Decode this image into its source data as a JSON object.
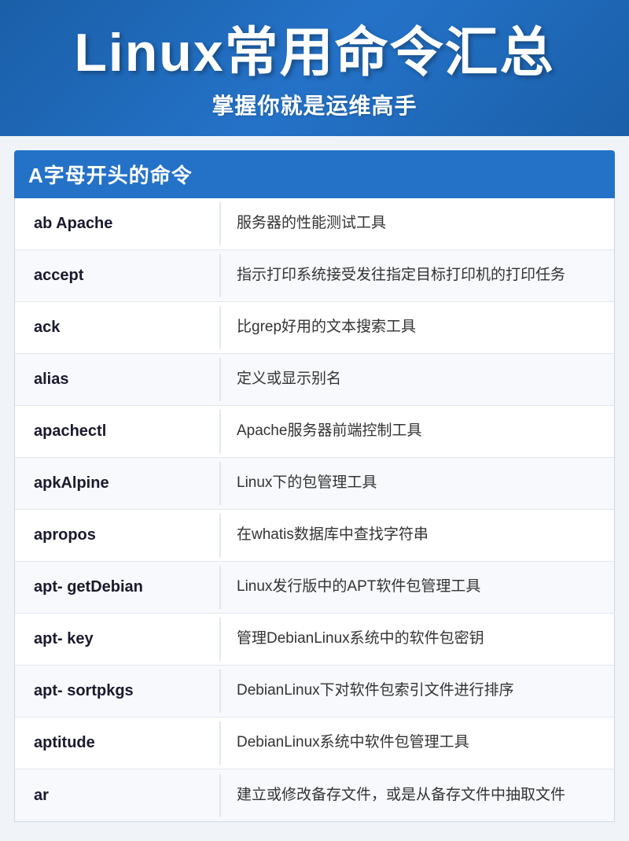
{
  "header": {
    "main_title": "Linux常用命令汇总",
    "sub_title": "掌握你就是运维高手"
  },
  "section": {
    "header": "A字母开头的命令",
    "commands": [
      {
        "name": "ab  Apache",
        "desc": "服务器的性能测试工具"
      },
      {
        "name": "accept",
        "desc": "指示打印系统接受发往指定目标打印机的打印任务"
      },
      {
        "name": "ack",
        "desc": "比grep好用的文本搜索工具"
      },
      {
        "name": "alias",
        "desc": "定义或显示别名"
      },
      {
        "name": "apachectl",
        "desc": "Apache服务器前端控制工具"
      },
      {
        "name": "apkAlpine",
        "desc": "Linux下的包管理工具"
      },
      {
        "name": "apropos",
        "desc": "在whatis数据库中查找字符串"
      },
      {
        "name": "apt-  getDebian",
        "desc": "Linux发行版中的APT软件包管理工具"
      },
      {
        "name": "apt-  key",
        "desc": "管理DebianLinux系统中的软件包密钥"
      },
      {
        "name": "apt-  sortpkgs",
        "desc": "DebianLinux下对软件包索引文件进行排序"
      },
      {
        "name": "aptitude",
        "desc": "DebianLinux系统中软件包管理工具"
      },
      {
        "name": "ar",
        "desc": "建立或修改备存文件，或是从备存文件中抽取文件"
      }
    ]
  }
}
